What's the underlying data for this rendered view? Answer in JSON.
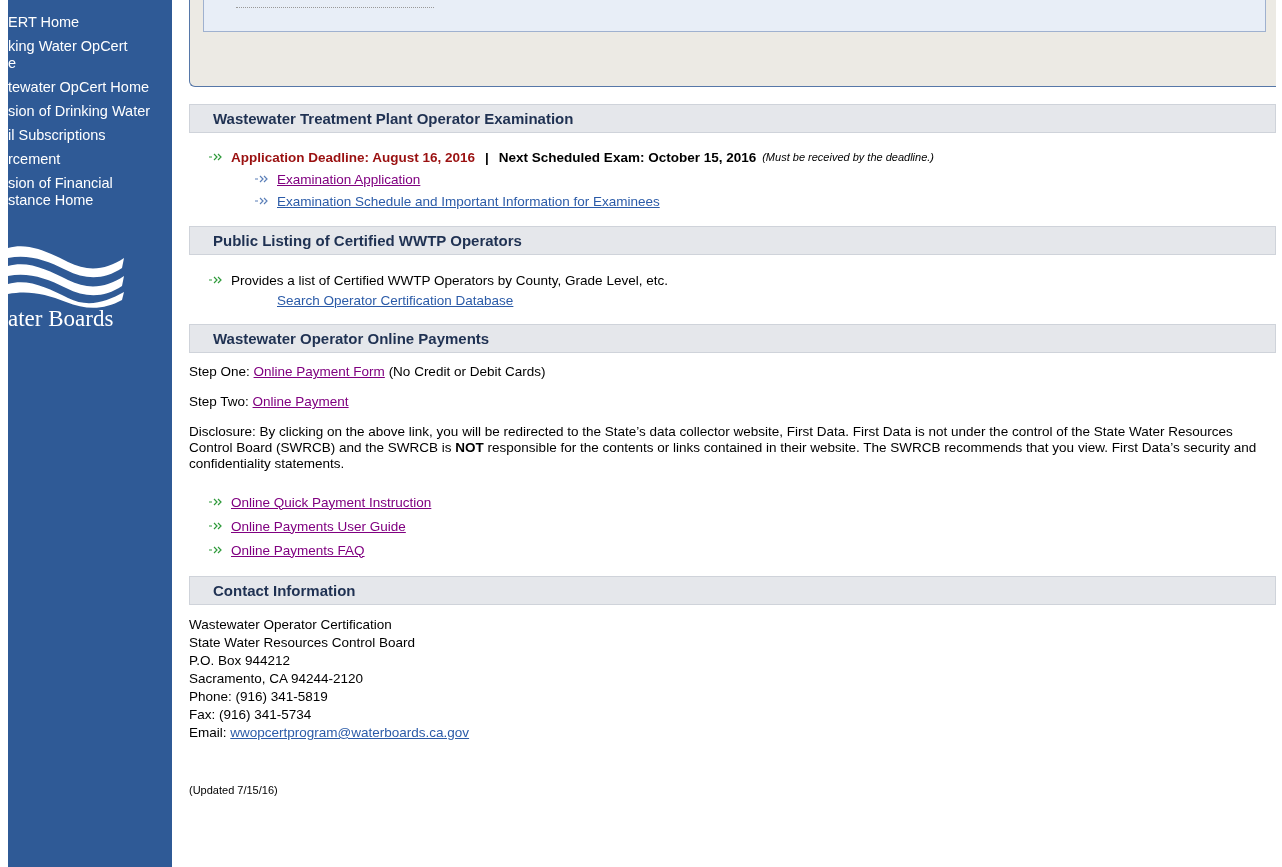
{
  "sidebar": {
    "items": [
      {
        "lines": [
          "ERT Home"
        ]
      },
      {
        "lines": [
          "king Water OpCert",
          "e"
        ]
      },
      {
        "lines": [
          "tewater OpCert Home"
        ]
      },
      {
        "lines": [
          "sion of Drinking Water"
        ]
      },
      {
        "lines": [
          "il Subscriptions"
        ]
      },
      {
        "lines": [
          "rcement"
        ]
      },
      {
        "lines": [
          "sion of Financial",
          "stance Home"
        ]
      }
    ],
    "logo_text": "ater Boards"
  },
  "sections": [
    {
      "kind": "exam",
      "title": "Wastewater Treatment Plant Operator Examination",
      "deadline": "Application Deadline: August 16, 2016",
      "separator": "|",
      "next_exam": "Next Scheduled Exam: October 15, 2016",
      "note": "(Must be received by the deadline.)",
      "links": [
        {
          "text": "Examination Application",
          "visited": true
        },
        {
          "text": "Examination Schedule and Important Information for Examinees",
          "visited": false
        }
      ]
    },
    {
      "kind": "listing",
      "title": "Public Listing of Certified WWTP Operators",
      "text": "Provides a list of Certified WWTP Operators by County, Grade Level, etc.",
      "link": {
        "text": "Search Operator Certification Database",
        "visited": false
      }
    },
    {
      "kind": "payments",
      "title": "Wastewater Operator Online Payments",
      "steps": [
        {
          "label": "Step One:",
          "link": {
            "text": "Online Payment Form",
            "visited": true
          },
          "after": "(No Credit or Debit Cards)"
        },
        {
          "label": "Step Two:",
          "link": {
            "text": "Online Payment",
            "visited": true
          }
        }
      ],
      "disclosure": "Disclosure: By clicking on the above link, you will be redirected to the State’s data collector website, First Data. First Data is not under the control of the State Water Resources Control Board (SWRCB) and the SWRCB is **NOT** responsible for the contents or links contained in their website. The SWRCB recommends that you view. First Data’s security and confidentiality statements.",
      "links": [
        {
          "text": "Online Quick Payment Instruction",
          "visited": true
        },
        {
          "text": "Online Payments User Guide",
          "visited": true
        },
        {
          "text": "Online Payments FAQ",
          "visited": true
        }
      ]
    },
    {
      "kind": "contact",
      "title": "Contact Information",
      "lines": [
        "Wastewater Operator Certification",
        "State Water Resources Control Board",
        "P.O. Box 944212",
        "Sacramento, CA 94244-2120",
        "Phone: (916) 341-5819",
        "Fax: (916) 341-5734"
      ],
      "email_label": "Email:",
      "email": {
        "text": "wwopcertprogram@waterboards.ca.gov",
        "visited": false
      }
    }
  ],
  "updated": "(Updated 7/15/16)"
}
